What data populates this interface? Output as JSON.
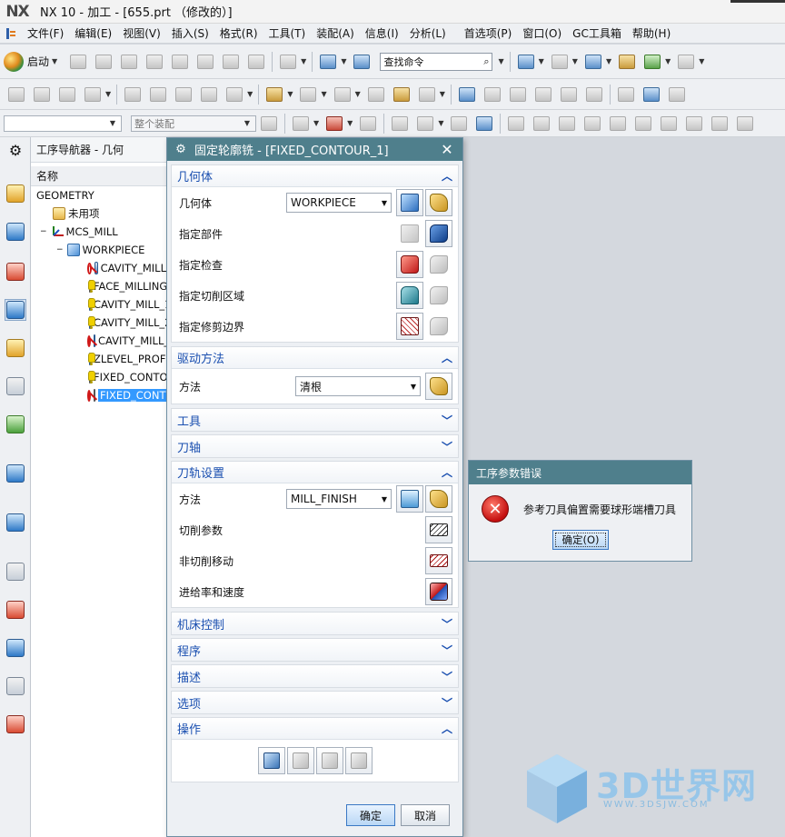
{
  "window": {
    "app_logo": "NX",
    "title": "NX 10 - 加工 - [655.prt （修改的）]"
  },
  "menubar": {
    "items": [
      "文件(F)",
      "编辑(E)",
      "视图(V)",
      "插入(S)",
      "格式(R)",
      "工具(T)",
      "装配(A)",
      "信息(I)",
      "分析(L)",
      "首选项(P)",
      "窗口(O)",
      "GC工具箱",
      "帮助(H)"
    ]
  },
  "toolbar": {
    "start_label": "启动",
    "search_placeholder": "查找命令",
    "filter_combo": "",
    "assembly_combo": "整个装配"
  },
  "navigator": {
    "title": "工序导航器 - 几何",
    "column_name": "名称",
    "rows": [
      {
        "label": "GEOMETRY"
      },
      {
        "label": "未用项"
      },
      {
        "label": "MCS_MILL"
      },
      {
        "label": "WORKPIECE"
      },
      {
        "label": "CAVITY_MILL"
      },
      {
        "label": "FACE_MILLING"
      },
      {
        "label": "CAVITY_MILL_1"
      },
      {
        "label": "CAVITY_MILL_2"
      },
      {
        "label": "CAVITY_MILL_3"
      },
      {
        "label": "ZLEVEL_PROFILE"
      },
      {
        "label": "FIXED_CONTOUR"
      },
      {
        "label": "FIXED_CONTOUR_1"
      }
    ]
  },
  "dialog": {
    "title": "固定轮廓铣 - [FIXED_CONTOUR_1]",
    "geometry": {
      "header": "几何体",
      "geometry_label": "几何体",
      "geometry_value": "WORKPIECE",
      "part_label": "指定部件",
      "check_label": "指定检查",
      "cut_area_label": "指定切削区域",
      "trim_label": "指定修剪边界"
    },
    "drive": {
      "header": "驱动方法",
      "method_label": "方法",
      "method_value": "清根"
    },
    "tool_header": "工具",
    "axis_header": "刀轴",
    "path": {
      "header": "刀轨设置",
      "method_label": "方法",
      "method_value": "MILL_FINISH",
      "cut_params": "切削参数",
      "non_cut": "非切削移动",
      "feeds": "进给率和速度"
    },
    "machine_header": "机床控制",
    "program_header": "程序",
    "desc_header": "描述",
    "options_header": "选项",
    "ops_header": "操作",
    "ok": "确定",
    "cancel": "取消"
  },
  "error": {
    "title": "工序参数错误",
    "message": "参考刀具偏置需要球形端槽刀具",
    "ok": "确定(O)"
  },
  "watermark": {
    "text": "3D世界网",
    "url": "WWW.3DSJW.COM"
  }
}
